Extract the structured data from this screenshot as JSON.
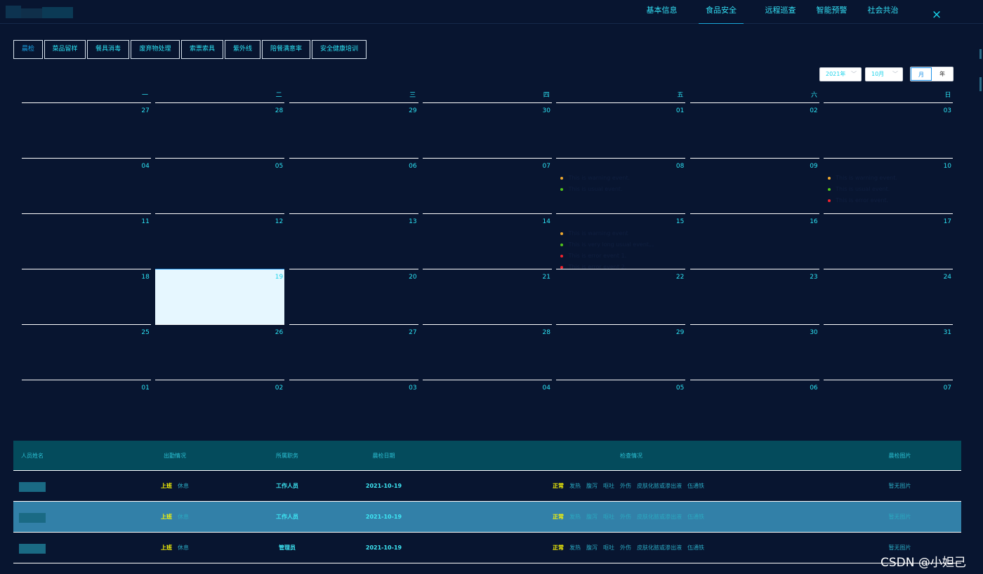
{
  "header": {
    "nav": [
      "基本信息",
      "食品安全",
      "远程巡查",
      "智能预警",
      "社会共治"
    ],
    "active_nav": 1,
    "close_icon": "×"
  },
  "tabs": [
    "晨检",
    "菜品留样",
    "餐具消毒",
    "废弃物处理",
    "索票索具",
    "紫外线",
    "陪餐满意率",
    "安全健康培训"
  ],
  "calendar": {
    "year_select": "2021年",
    "month_select": "10月",
    "view_month": "月",
    "view_year": "年",
    "weekdays": [
      "一",
      "二",
      "三",
      "四",
      "五",
      "六",
      "日"
    ],
    "weeks": [
      [
        "27",
        "28",
        "29",
        "30",
        "01",
        "02",
        "03"
      ],
      [
        "04",
        "05",
        "06",
        "07",
        "08",
        "09",
        "10"
      ],
      [
        "11",
        "12",
        "13",
        "14",
        "15",
        "16",
        "17"
      ],
      [
        "18",
        "19",
        "20",
        "21",
        "22",
        "23",
        "24"
      ],
      [
        "25",
        "26",
        "27",
        "28",
        "29",
        "30",
        "31"
      ],
      [
        "01",
        "02",
        "03",
        "04",
        "05",
        "06",
        "07"
      ]
    ],
    "today": [
      3,
      1
    ],
    "events": {
      "1-4": [
        {
          "text": "This is warning event.",
          "color": "#f0a92e"
        },
        {
          "text": "This is usual event.",
          "color": "#52c41a"
        }
      ],
      "1-6": [
        {
          "text": "This is warning event.",
          "color": "#f0a92e"
        },
        {
          "text": "This is usual event.",
          "color": "#52c41a"
        },
        {
          "text": "This is error event.",
          "color": "#f5222d"
        }
      ],
      "2-4": [
        {
          "text": "This is warning event",
          "color": "#f0a92e"
        },
        {
          "text": "This is very long usual event。。",
          "color": "#52c41a"
        },
        {
          "text": "This is error event 1.",
          "color": "#f5222d"
        },
        {
          "text": "This is error event 2.",
          "color": "#f5222d"
        }
      ]
    }
  },
  "table": {
    "headers": [
      "人员姓名",
      "出勤情况",
      "所属职务",
      "晨检日期",
      "检查情况",
      "晨检图片"
    ],
    "rows": [
      {
        "shift": "上班",
        "rest": "休息",
        "job": "工作人员",
        "date": "2021-10-19",
        "status": "正常",
        "symptoms": [
          "发热",
          "腹泻",
          "呕吐",
          "外伤",
          "皮肤化脓或渗出液",
          "伍通铁"
        ],
        "pic": "暂无图片",
        "highlight": false
      },
      {
        "shift": "上班",
        "rest": "休息",
        "job": "工作人员",
        "date": "2021-10-19",
        "status": "正常",
        "symptoms": [
          "发热",
          "腹泻",
          "呕吐",
          "外伤",
          "皮肤化脓或渗出液",
          "伍通铁"
        ],
        "pic": "暂无图片",
        "highlight": true
      },
      {
        "shift": "上班",
        "rest": "休息",
        "job": "管理员",
        "date": "2021-10-19",
        "status": "正常",
        "symptoms": [
          "发热",
          "腹泻",
          "呕吐",
          "外伤",
          "皮肤化脓或渗出液",
          "伍通铁"
        ],
        "pic": "暂无图片",
        "highlight": false
      }
    ]
  },
  "watermark": "CSDN @小妲己",
  "colors": {
    "background": "#081530",
    "accent": "#19d9f0",
    "table_header": "#044b5c",
    "highlight_row": "#3280a8",
    "today_cell": "#e6f7ff",
    "warning": "#f0a92e",
    "usual": "#52c41a",
    "error": "#f5222d"
  }
}
